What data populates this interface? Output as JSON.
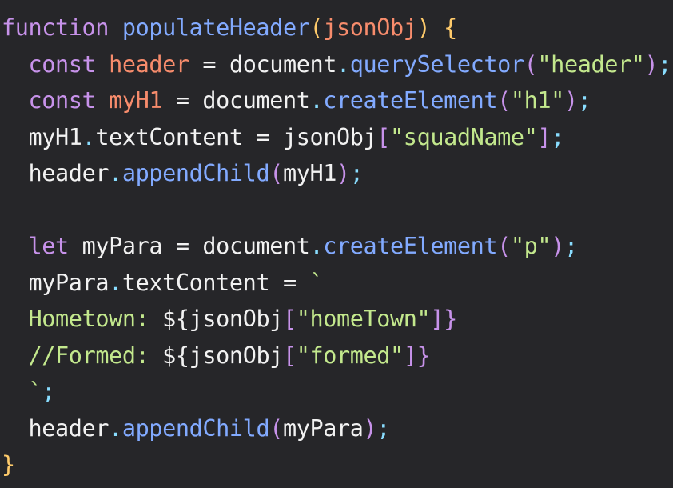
{
  "editor": {
    "background": "#262629",
    "lines": [
      [
        {
          "text": "function",
          "type": "keyword"
        },
        {
          "text": " ",
          "type": "plain"
        },
        {
          "text": "populateHeader",
          "type": "func"
        },
        {
          "text": "(",
          "type": "brace-gold"
        },
        {
          "text": "jsonObj",
          "type": "param"
        },
        {
          "text": ")",
          "type": "brace-gold"
        },
        {
          "text": " ",
          "type": "plain"
        },
        {
          "text": "{",
          "type": "brace-gold"
        }
      ],
      [
        {
          "text": "  ",
          "type": "plain"
        },
        {
          "text": "const",
          "type": "keyword"
        },
        {
          "text": " ",
          "type": "plain"
        },
        {
          "text": "header",
          "type": "var"
        },
        {
          "text": " = ",
          "type": "plain"
        },
        {
          "text": "document",
          "type": "obj"
        },
        {
          "text": ".",
          "type": "punct"
        },
        {
          "text": "querySelector",
          "type": "method"
        },
        {
          "text": "(",
          "type": "paren-purple"
        },
        {
          "text": "\"header\"",
          "type": "string"
        },
        {
          "text": ")",
          "type": "paren-purple"
        },
        {
          "text": ";",
          "type": "punct"
        }
      ],
      [
        {
          "text": "  ",
          "type": "plain"
        },
        {
          "text": "const",
          "type": "keyword"
        },
        {
          "text": " ",
          "type": "plain"
        },
        {
          "text": "myH1",
          "type": "var"
        },
        {
          "text": " = ",
          "type": "plain"
        },
        {
          "text": "document",
          "type": "obj"
        },
        {
          "text": ".",
          "type": "punct"
        },
        {
          "text": "createElement",
          "type": "method"
        },
        {
          "text": "(",
          "type": "paren-purple"
        },
        {
          "text": "\"h1\"",
          "type": "string"
        },
        {
          "text": ")",
          "type": "paren-purple"
        },
        {
          "text": ";",
          "type": "punct"
        }
      ],
      [
        {
          "text": "  ",
          "type": "plain"
        },
        {
          "text": "myH1",
          "type": "obj"
        },
        {
          "text": ".",
          "type": "punct"
        },
        {
          "text": "textContent",
          "type": "obj"
        },
        {
          "text": " = ",
          "type": "plain"
        },
        {
          "text": "jsonObj",
          "type": "obj"
        },
        {
          "text": "[",
          "type": "bracket-pink"
        },
        {
          "text": "\"squadName\"",
          "type": "string"
        },
        {
          "text": "]",
          "type": "bracket-pink"
        },
        {
          "text": ";",
          "type": "punct"
        }
      ],
      [
        {
          "text": "  ",
          "type": "plain"
        },
        {
          "text": "header",
          "type": "obj"
        },
        {
          "text": ".",
          "type": "punct"
        },
        {
          "text": "appendChild",
          "type": "method"
        },
        {
          "text": "(",
          "type": "paren-purple"
        },
        {
          "text": "myH1",
          "type": "obj"
        },
        {
          "text": ")",
          "type": "paren-purple"
        },
        {
          "text": ";",
          "type": "punct"
        }
      ],
      [],
      [
        {
          "text": "  ",
          "type": "plain"
        },
        {
          "text": "let",
          "type": "keyword"
        },
        {
          "text": " ",
          "type": "plain"
        },
        {
          "text": "myPara",
          "type": "obj"
        },
        {
          "text": " = ",
          "type": "plain"
        },
        {
          "text": "document",
          "type": "obj"
        },
        {
          "text": ".",
          "type": "punct"
        },
        {
          "text": "createElement",
          "type": "method"
        },
        {
          "text": "(",
          "type": "paren-purple"
        },
        {
          "text": "\"p\"",
          "type": "string"
        },
        {
          "text": ")",
          "type": "paren-purple"
        },
        {
          "text": ";",
          "type": "punct"
        }
      ],
      [
        {
          "text": "  ",
          "type": "plain"
        },
        {
          "text": "myPara",
          "type": "obj"
        },
        {
          "text": ".",
          "type": "punct"
        },
        {
          "text": "textContent",
          "type": "obj"
        },
        {
          "text": " = ",
          "type": "plain"
        },
        {
          "text": "`",
          "type": "template"
        }
      ],
      [
        {
          "text": "  ",
          "type": "plain"
        },
        {
          "text": "Hometown: ",
          "type": "template"
        },
        {
          "text": "${",
          "type": "obj"
        },
        {
          "text": "jsonObj",
          "type": "obj"
        },
        {
          "text": "[",
          "type": "bracket-pink"
        },
        {
          "text": "\"homeTown\"",
          "type": "string"
        },
        {
          "text": "]",
          "type": "bracket-pink"
        },
        {
          "text": "}",
          "type": "bracket-pink"
        }
      ],
      [
        {
          "text": "  ",
          "type": "plain"
        },
        {
          "text": "//Formed: ",
          "type": "template"
        },
        {
          "text": "${",
          "type": "obj"
        },
        {
          "text": "jsonObj",
          "type": "obj"
        },
        {
          "text": "[",
          "type": "bracket-pink"
        },
        {
          "text": "\"formed\"",
          "type": "string"
        },
        {
          "text": "]",
          "type": "bracket-pink"
        },
        {
          "text": "}",
          "type": "bracket-pink"
        }
      ],
      [
        {
          "text": "  ",
          "type": "plain"
        },
        {
          "text": "`",
          "type": "template"
        },
        {
          "text": ";",
          "type": "punct"
        }
      ],
      [
        {
          "text": "  ",
          "type": "plain"
        },
        {
          "text": "header",
          "type": "obj"
        },
        {
          "text": ".",
          "type": "punct"
        },
        {
          "text": "appendChild",
          "type": "method"
        },
        {
          "text": "(",
          "type": "paren-purple"
        },
        {
          "text": "myPara",
          "type": "obj"
        },
        {
          "text": ")",
          "type": "paren-purple"
        },
        {
          "text": ";",
          "type": "punct"
        }
      ],
      [
        {
          "text": "}",
          "type": "brace-gold"
        }
      ]
    ]
  }
}
